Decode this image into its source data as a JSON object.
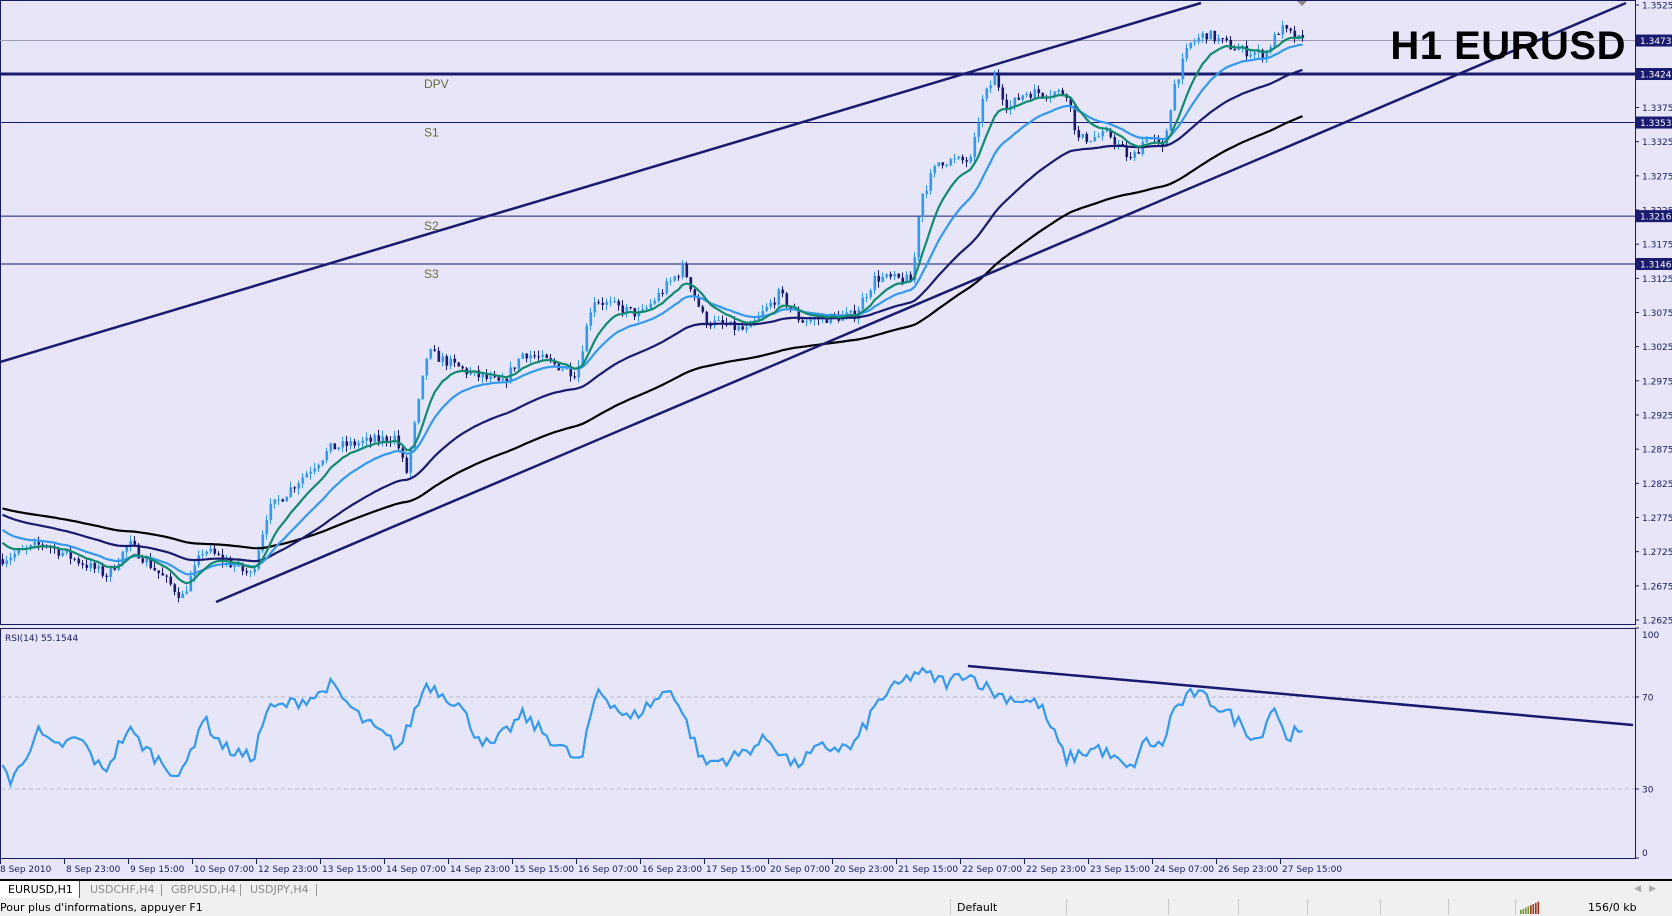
{
  "chart": {
    "title": "H1 EURUSD",
    "symbol": "EURUSD",
    "timeframe": "H1",
    "price_axis": [
      "1.3525",
      "1.3475",
      "1.3425",
      "1.3375",
      "1.3325",
      "1.3275",
      "1.3225",
      "1.3175",
      "1.3125",
      "1.3075",
      "1.3025",
      "1.2975",
      "1.2925",
      "1.2875",
      "1.2825",
      "1.2775",
      "1.2725",
      "1.2675",
      "1.2625"
    ],
    "price_range": [
      1.2625,
      1.3525
    ],
    "levels": [
      {
        "label": "",
        "price": 1.3473,
        "tag": "1.3473",
        "style": "current-bid"
      },
      {
        "label": "DPV",
        "price": 1.3424,
        "tag": "1.3424",
        "style": "pivot"
      },
      {
        "label": "S1",
        "price": 1.3353,
        "tag": "1.3353",
        "style": "support"
      },
      {
        "label": "S2",
        "price": 1.3216,
        "tag": "1.3216",
        "style": "support"
      },
      {
        "label": "S3",
        "price": 1.3146,
        "tag": "1.3146",
        "style": "support"
      }
    ],
    "time_axis": [
      "8 Sep 2010",
      "8 Sep 23:00",
      "9 Sep 15:00",
      "10 Sep 07:00",
      "12 Sep 23:00",
      "13 Sep 15:00",
      "14 Sep 07:00",
      "14 Sep 23:00",
      "15 Sep 15:00",
      "16 Sep 07:00",
      "16 Sep 23:00",
      "17 Sep 15:00",
      "20 Sep 07:00",
      "20 Sep 23:00",
      "21 Sep 15:00",
      "22 Sep 07:00",
      "22 Sep 23:00",
      "23 Sep 15:00",
      "24 Sep 07:00",
      "26 Sep 23:00",
      "27 Sep 15:00"
    ],
    "colors": {
      "background": "#e6e6f8",
      "bull_candle": "#3399ee",
      "bear_candle": "#1a1a6e",
      "ma_fast": "#128a6e",
      "ma_medium": "#3399ee",
      "ma_slow": "#1a1a6e",
      "ma_long": "#000000",
      "trendline": "#1a1a6e"
    }
  },
  "rsi": {
    "label": "RSI(14) 55.1544",
    "value": 55.1544,
    "axis": [
      "100",
      "70",
      "30",
      "0"
    ],
    "range": [
      0,
      100
    ],
    "levels": [
      70,
      30
    ],
    "color": "#3399ee"
  },
  "tabs": [
    {
      "label": "EURUSD,H1",
      "active": true
    },
    {
      "label": "USDCHF,H4",
      "active": false
    },
    {
      "label": "GBPUSD,H4",
      "active": false
    },
    {
      "label": "USDJPY,H4",
      "active": false
    }
  ],
  "status": {
    "help": "Pour plus d'informations, appuyer F1",
    "profile": "Default",
    "traffic": "156/0 kb",
    "connection_icon": "connection-bars-icon"
  }
}
